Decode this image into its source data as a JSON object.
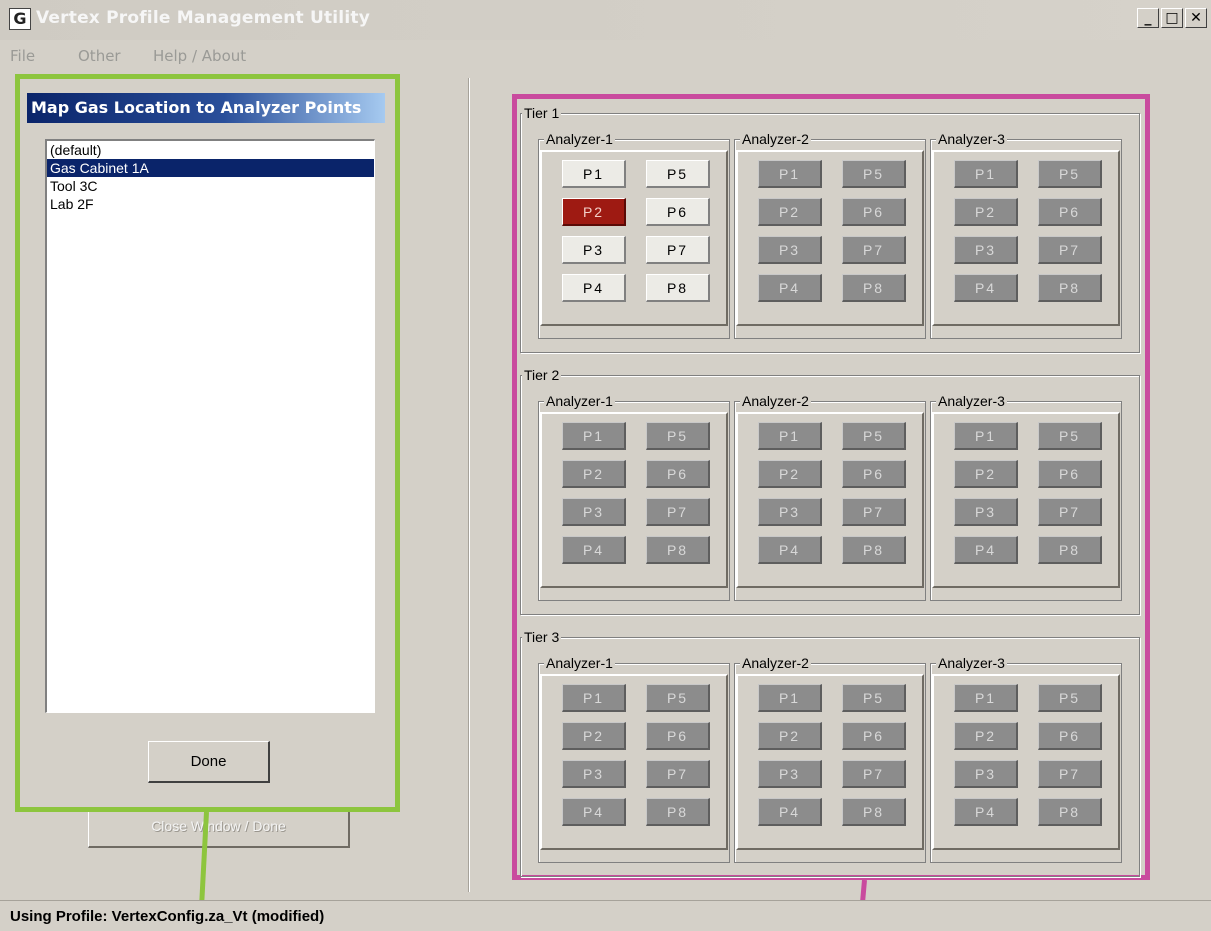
{
  "window": {
    "title": "Vertex Profile Management Utility",
    "app_icon_glyph": "G",
    "controls": {
      "minimize": "_",
      "maximize": "□",
      "close": "✕"
    }
  },
  "menu": [
    "File",
    "Other",
    "Help / About"
  ],
  "map_panel": {
    "header": "Map Gas Location to Analyzer Points",
    "locations": [
      "(default)",
      "Gas Cabinet 1A",
      "Tool 3C",
      "Lab 2F"
    ],
    "selected_index": 1,
    "done_label": "Done"
  },
  "background_button": {
    "label": "Close Window / Done"
  },
  "tiers": [
    {
      "label": "Tier 1",
      "analyzers": [
        {
          "label": "Analyzer-1",
          "points": [
            "P1",
            "P2",
            "P3",
            "P4",
            "P5",
            "P6",
            "P7",
            "P8"
          ],
          "state": "active",
          "selected_point": "P2"
        },
        {
          "label": "Analyzer-2",
          "points": [
            "P1",
            "P2",
            "P3",
            "P4",
            "P5",
            "P6",
            "P7",
            "P8"
          ],
          "state": "dim"
        },
        {
          "label": "Analyzer-3",
          "points": [
            "P1",
            "P2",
            "P3",
            "P4",
            "P5",
            "P6",
            "P7",
            "P8"
          ],
          "state": "dim"
        }
      ]
    },
    {
      "label": "Tier 2",
      "analyzers": [
        {
          "label": "Analyzer-1",
          "points": [
            "P1",
            "P2",
            "P3",
            "P4",
            "P5",
            "P6",
            "P7",
            "P8"
          ],
          "state": "dim"
        },
        {
          "label": "Analyzer-2",
          "points": [
            "P1",
            "P2",
            "P3",
            "P4",
            "P5",
            "P6",
            "P7",
            "P8"
          ],
          "state": "dim"
        },
        {
          "label": "Analyzer-3",
          "points": [
            "P1",
            "P2",
            "P3",
            "P4",
            "P5",
            "P6",
            "P7",
            "P8"
          ],
          "state": "dim"
        }
      ]
    },
    {
      "label": "Tier 3",
      "analyzers": [
        {
          "label": "Analyzer-1",
          "points": [
            "P1",
            "P2",
            "P3",
            "P4",
            "P5",
            "P6",
            "P7",
            "P8"
          ],
          "state": "dim"
        },
        {
          "label": "Analyzer-2",
          "points": [
            "P1",
            "P2",
            "P3",
            "P4",
            "P5",
            "P6",
            "P7",
            "P8"
          ],
          "state": "dim"
        },
        {
          "label": "Analyzer-3",
          "points": [
            "P1",
            "P2",
            "P3",
            "P4",
            "P5",
            "P6",
            "P7",
            "P8"
          ],
          "state": "dim"
        }
      ]
    }
  ],
  "status": "Using Profile:  VertexConfig.za_Vt  (modified)",
  "colors": {
    "callout_green": "#8dc53e",
    "callout_magenta": "#c94b9e",
    "selected_point": "#9e1a12",
    "disabled_point": "#8c8c8c",
    "selection_highlight": "#0a246a"
  }
}
